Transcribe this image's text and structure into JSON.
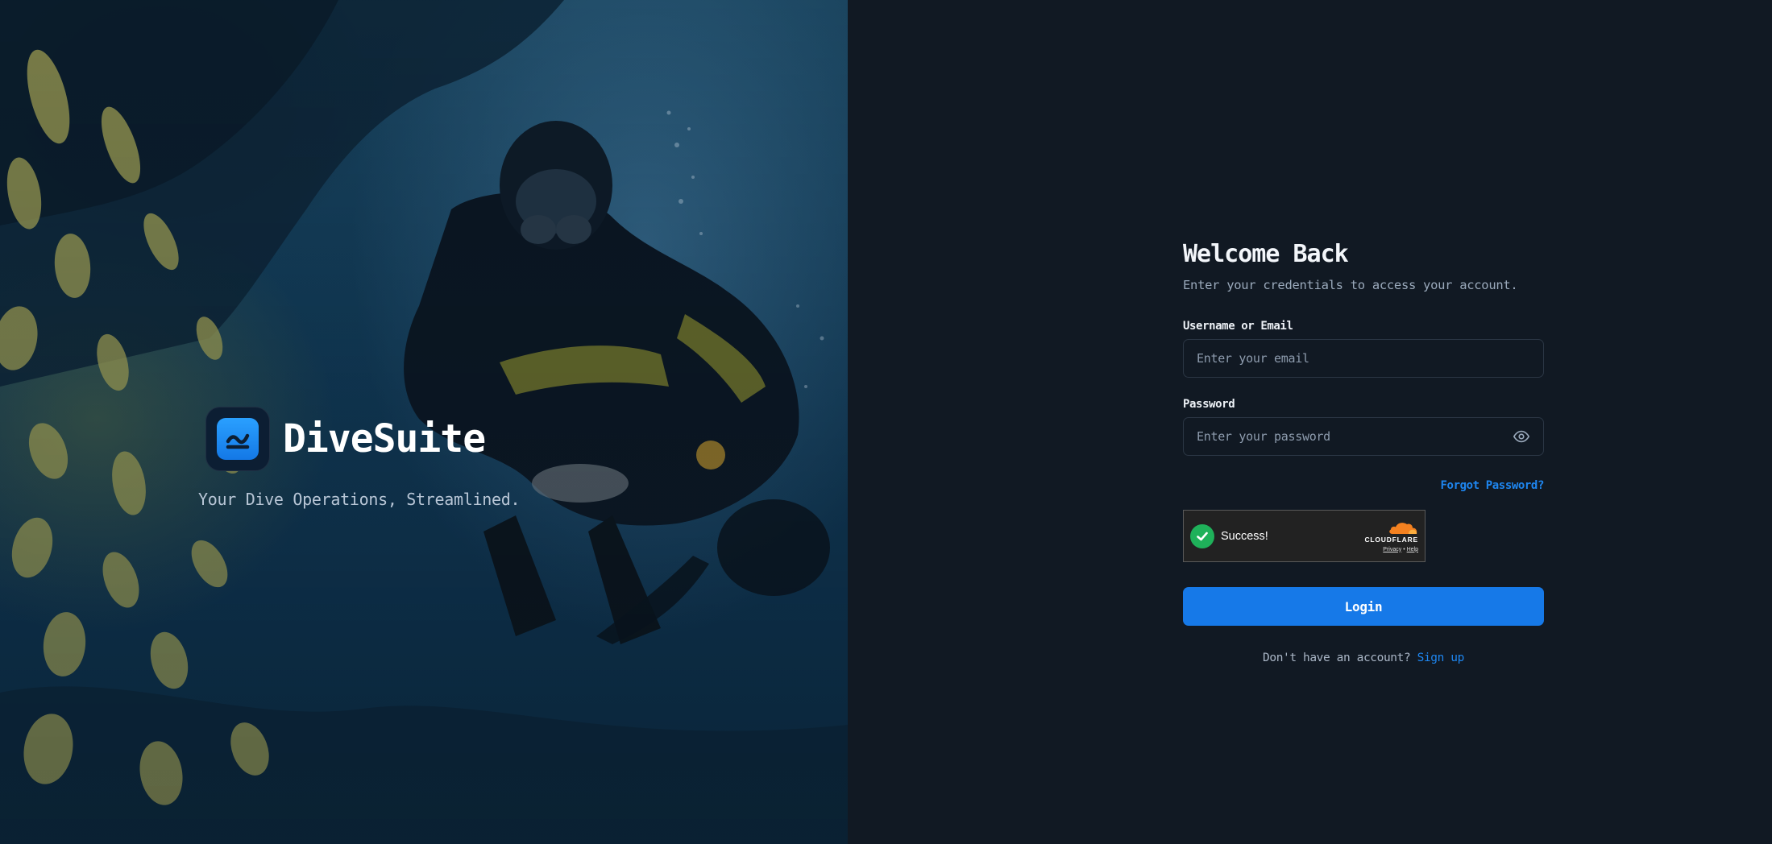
{
  "hero": {
    "brand_name": "DiveSuite",
    "tagline": "Your Dive Operations, Streamlined.",
    "logo_icon": "wave-icon",
    "background": "underwater-scuba-diver-photo"
  },
  "login": {
    "title": "Welcome Back",
    "subtitle": "Enter your credentials to access your account.",
    "username_label": "Username or Email",
    "username_placeholder": "Enter your email",
    "username_value": "",
    "password_label": "Password",
    "password_placeholder": "Enter your password",
    "password_value": "",
    "password_toggle_icon": "eye-icon",
    "forgot_password": "Forgot Password?",
    "captcha": {
      "status": "Success!",
      "provider": "CLOUDFLARE",
      "privacy": "Privacy",
      "separator": "•",
      "help": "Help"
    },
    "login_button": "Login",
    "signup_prompt": "Don't have an account?",
    "signup_link": "Sign up"
  },
  "colors": {
    "accent": "#1679e8",
    "link": "#1e86f0",
    "panel_bg": "#111923",
    "success": "#1fb15a",
    "cloudflare_orange": "#f48120"
  }
}
